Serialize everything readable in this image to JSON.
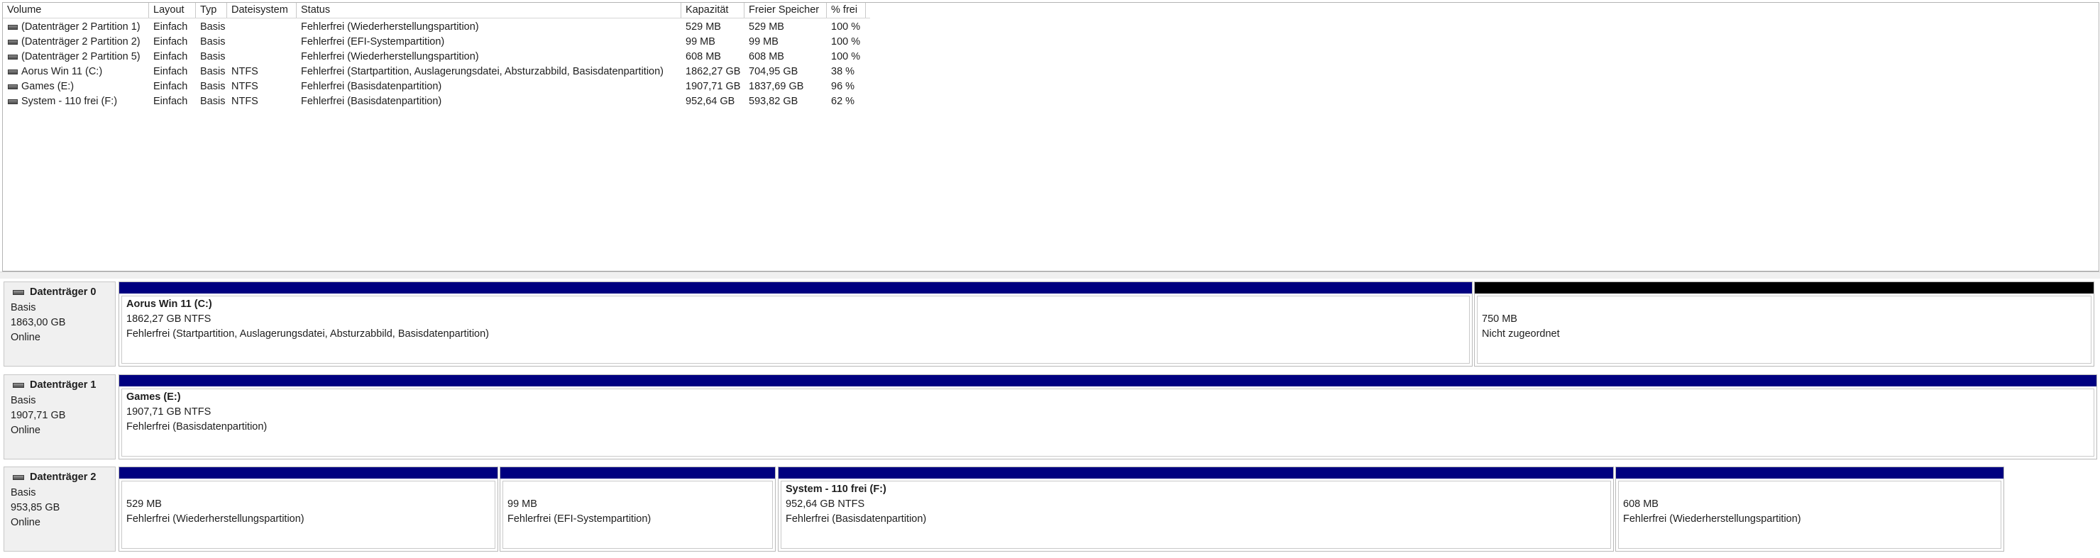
{
  "columns": [
    "Volume",
    "Layout",
    "Typ",
    "Dateisystem",
    "Status",
    "Kapazität",
    "Freier Speicher",
    "% frei"
  ],
  "volumes": [
    {
      "volume": "(Datenträger 2 Partition 1)",
      "layout": "Einfach",
      "typ": "Basis",
      "fs": "",
      "status": "Fehlerfrei (Wiederherstellungspartition)",
      "capacity": "529 MB",
      "free": "529 MB",
      "pct": "100 %"
    },
    {
      "volume": "(Datenträger 2 Partition 2)",
      "layout": "Einfach",
      "typ": "Basis",
      "fs": "",
      "status": "Fehlerfrei (EFI-Systempartition)",
      "capacity": "99 MB",
      "free": "99 MB",
      "pct": "100 %"
    },
    {
      "volume": "(Datenträger 2 Partition 5)",
      "layout": "Einfach",
      "typ": "Basis",
      "fs": "",
      "status": "Fehlerfrei (Wiederherstellungspartition)",
      "capacity": "608 MB",
      "free": "608 MB",
      "pct": "100 %"
    },
    {
      "volume": "Aorus Win 11 (C:)",
      "layout": "Einfach",
      "typ": "Basis",
      "fs": "NTFS",
      "status": "Fehlerfrei (Startpartition, Auslagerungsdatei, Absturzabbild, Basisdatenpartition)",
      "capacity": "1862,27 GB",
      "free": "704,95 GB",
      "pct": "38 %"
    },
    {
      "volume": "Games (E:)",
      "layout": "Einfach",
      "typ": "Basis",
      "fs": "NTFS",
      "status": "Fehlerfrei (Basisdatenpartition)",
      "capacity": "1907,71 GB",
      "free": "1837,69 GB",
      "pct": "96 %"
    },
    {
      "volume": "System - 110 frei (F:)",
      "layout": "Einfach",
      "typ": "Basis",
      "fs": "NTFS",
      "status": "Fehlerfrei (Basisdatenpartition)",
      "capacity": "952,64 GB",
      "free": "593,82 GB",
      "pct": "62 %"
    }
  ],
  "disks": [
    {
      "name": "Datenträger 0",
      "type": "Basis",
      "size": "1863,00 GB",
      "state": "Online",
      "partitions": [
        {
          "title": "Aorus Win 11  (C:)",
          "size": "1862,27 GB NTFS",
          "status": "Fehlerfrei (Startpartition, Auslagerungsdatei, Absturzabbild, Basisdatenpartition)",
          "kind": "primary"
        },
        {
          "title": "",
          "size": "750 MB",
          "status": "Nicht zugeordnet",
          "kind": "unallocated"
        }
      ]
    },
    {
      "name": "Datenträger 1",
      "type": "Basis",
      "size": "1907,71 GB",
      "state": "Online",
      "partitions": [
        {
          "title": "Games  (E:)",
          "size": "1907,71 GB NTFS",
          "status": "Fehlerfrei (Basisdatenpartition)",
          "kind": "primary"
        }
      ]
    },
    {
      "name": "Datenträger 2",
      "type": "Basis",
      "size": "953,85 GB",
      "state": "Online",
      "partitions": [
        {
          "title": "",
          "size": "529 MB",
          "status": "Fehlerfrei (Wiederherstellungspartition)",
          "kind": "primary"
        },
        {
          "title": "",
          "size": "99 MB",
          "status": "Fehlerfrei (EFI-Systempartition)",
          "kind": "primary"
        },
        {
          "title": "System - 110 frei  (F:)",
          "size": "952,64 GB NTFS",
          "status": "Fehlerfrei (Basisdatenpartition)",
          "kind": "primary"
        },
        {
          "title": "",
          "size": "608 MB",
          "status": "Fehlerfrei (Wiederherstellungspartition)",
          "kind": "primary"
        }
      ]
    }
  ],
  "colors": {
    "partition_bar": "#000080",
    "unallocated_bar": "#000000",
    "label_bg": "#f0f0f0"
  }
}
